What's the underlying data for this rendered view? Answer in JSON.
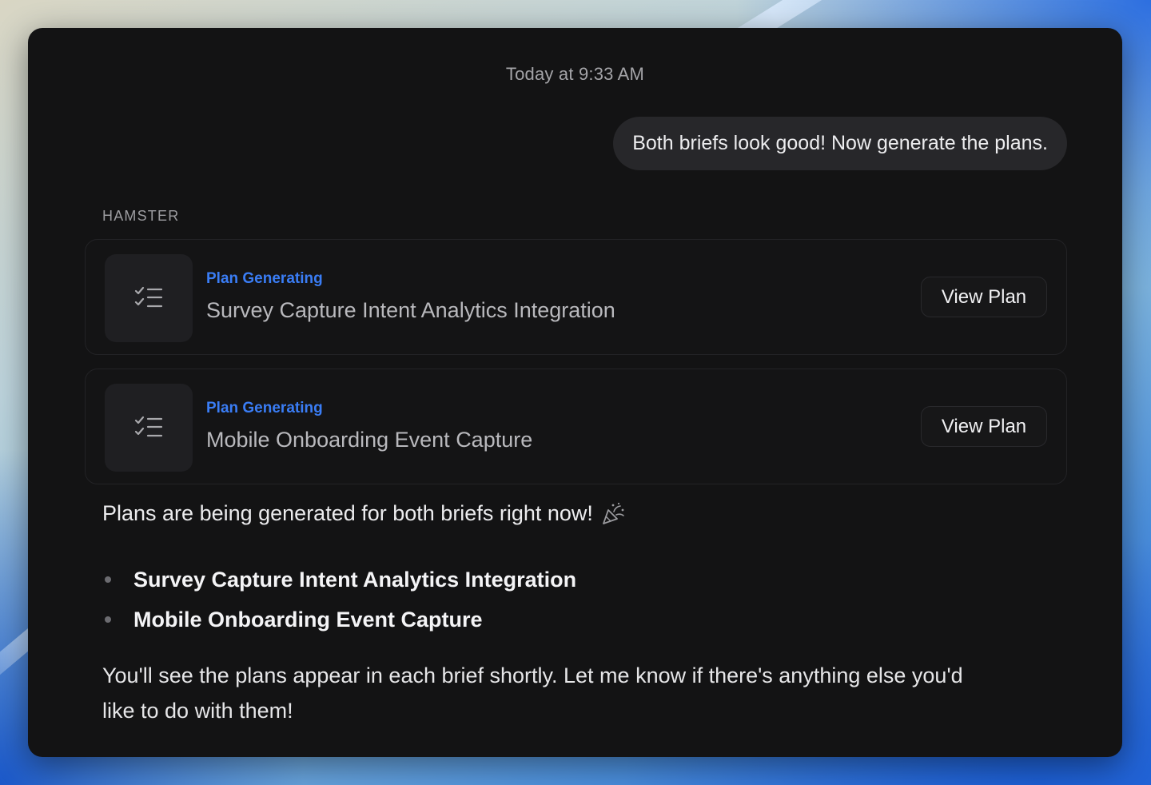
{
  "chat": {
    "timestamp": "Today at 9:33 AM",
    "user_message": "Both briefs look good! Now generate the plans.",
    "sender_name": "HAMSTER"
  },
  "plan_cards": [
    {
      "status": "Plan Generating",
      "title": "Survey Capture Intent Analytics Integration",
      "button_label": "View Plan",
      "icon": "checklist-icon"
    },
    {
      "status": "Plan Generating",
      "title": "Mobile Onboarding Event Capture",
      "button_label": "View Plan",
      "icon": "checklist-icon"
    }
  ],
  "reply": {
    "intro": "Plans are being generated for both briefs right now!",
    "intro_icon": "party-popper-icon",
    "bullets": [
      "Survey Capture Intent Analytics Integration",
      "Mobile Onboarding Event Capture"
    ],
    "closing": "You'll see the plans appear in each brief shortly. Let me know if there's anything else you'd like to do with them!"
  },
  "colors": {
    "window_bg": "#131314",
    "bubble_bg": "#27272a",
    "status_accent": "#3a7df5"
  }
}
